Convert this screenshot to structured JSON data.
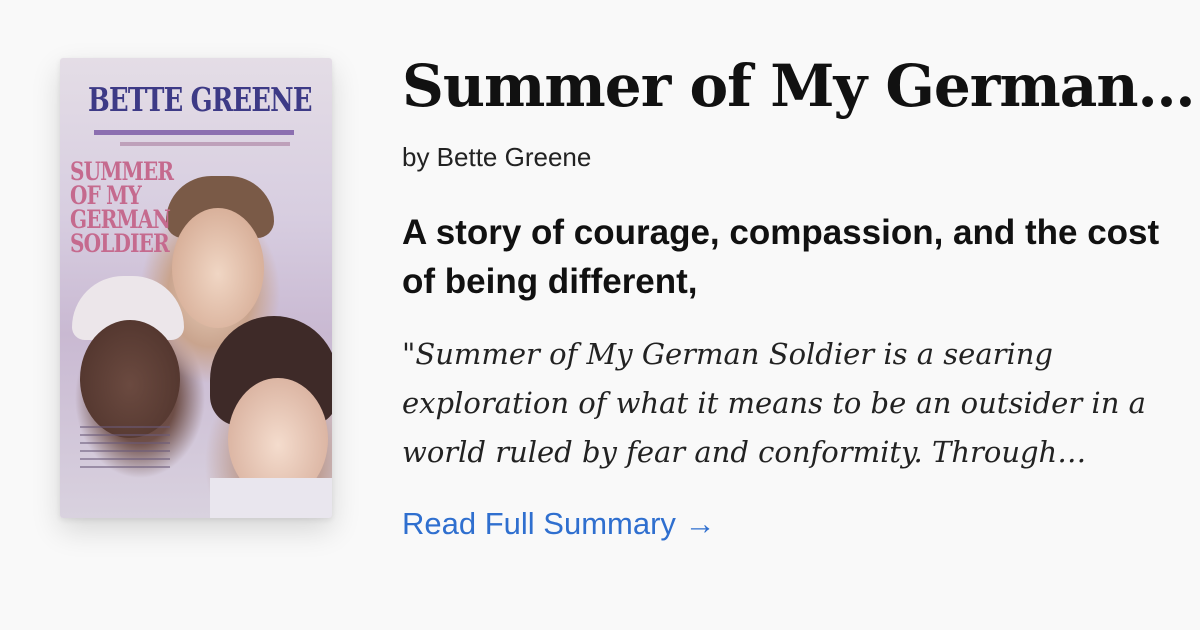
{
  "book": {
    "title": "Summer of My German…",
    "byline": "by Bette Greene",
    "headline": "A story of courage, compassion, and the cost of being different,",
    "excerpt": "\"Summer of My German Soldier is a searing exploration of what it means to be an outsider in a world ruled by fear and conformity. Through…",
    "read_more_label": "Read Full Summary →"
  },
  "cover": {
    "author": "BETTE GREENE",
    "title": "Summer of My German Soldier",
    "alt": "Summer of My German Soldier book cover"
  },
  "colors": {
    "background": "#f9f9f9",
    "link": "#2f6fcf",
    "cover_author": "#3d3a86",
    "cover_title": "#c56a8e"
  }
}
